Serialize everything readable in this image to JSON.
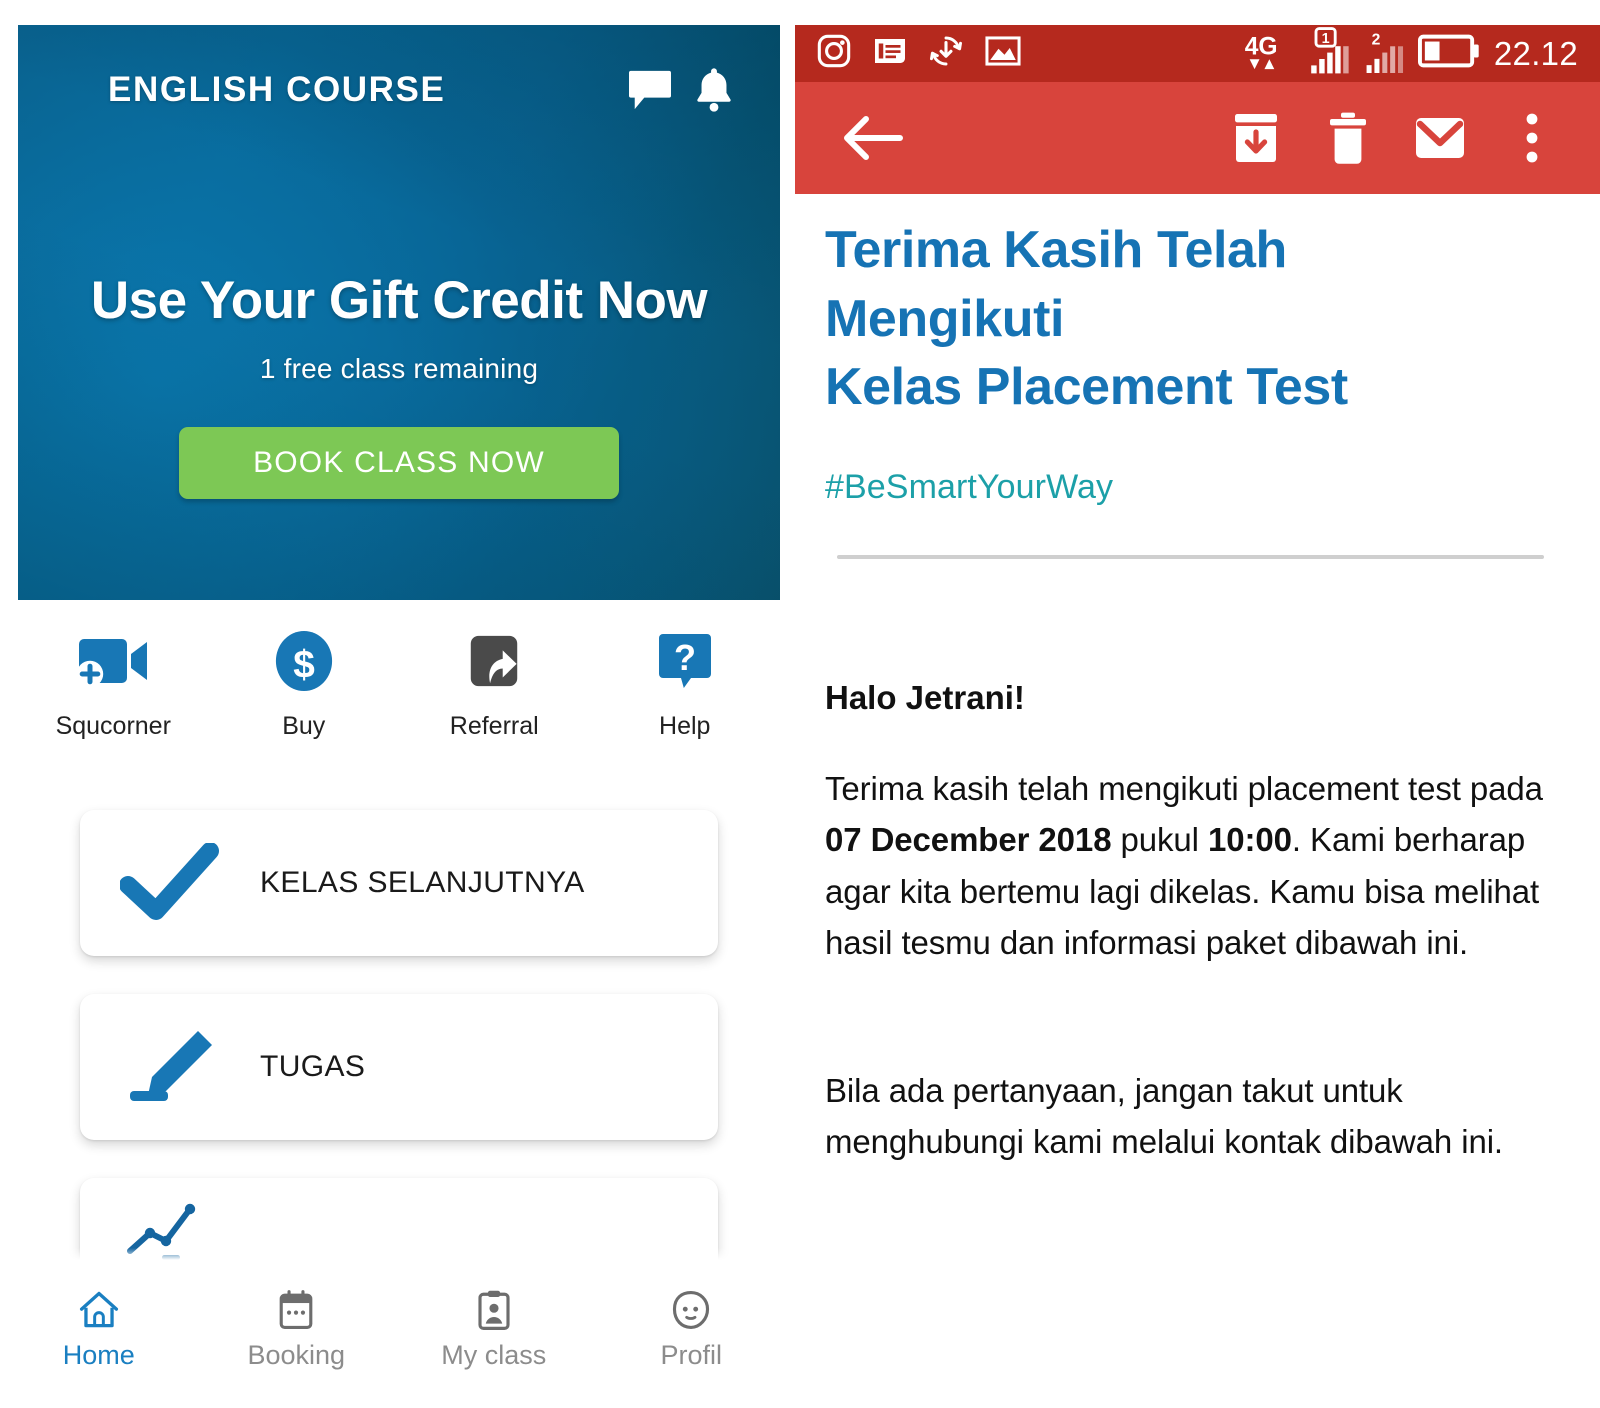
{
  "app": {
    "header": {
      "title": "ENGLISH COURSE",
      "chat_icon": "chat-bubble-icon",
      "bell_icon": "bell-icon"
    },
    "hero": {
      "headline": "Use Your Gift Credit Now",
      "subtext": "1 free class remaining",
      "button_label": "BOOK CLASS NOW",
      "button_color": "#7DC855",
      "background_color": "#0A6490"
    },
    "quick_actions": [
      {
        "label": "Squcorner",
        "icon": "video-camera-plus-icon",
        "color": "#1877B5"
      },
      {
        "label": "Buy",
        "icon": "dollar-circle-icon",
        "color": "#1877B5"
      },
      {
        "label": "Referral",
        "icon": "share-arrow-icon",
        "color": "#4A4A4A"
      },
      {
        "label": "Help",
        "icon": "question-bubble-icon",
        "color": "#1877B5"
      }
    ],
    "cards": [
      {
        "label": "KELAS SELANJUTNYA",
        "icon": "check-mark-icon"
      },
      {
        "label": "TUGAS",
        "icon": "marker-pen-icon"
      },
      {
        "label": "",
        "icon": "line-chart-icon"
      }
    ],
    "bottom_nav": [
      {
        "label": "Home",
        "icon": "home-icon",
        "active": true
      },
      {
        "label": "Booking",
        "icon": "calendar-icon",
        "active": false
      },
      {
        "label": "My class",
        "icon": "id-card-icon",
        "active": false
      },
      {
        "label": "Profil",
        "icon": "face-icon",
        "active": false
      }
    ],
    "accent_color": "#1a7fc1"
  },
  "mail": {
    "status_bar": {
      "background_color": "#B5291E",
      "left_icons": [
        "instagram-icon",
        "message-note-icon",
        "sync-download-icon",
        "photo-icon"
      ],
      "network": "4G",
      "sim1_label": "1",
      "sim2_label": "2",
      "battery_icon": "battery-icon",
      "time": "22.12"
    },
    "toolbar": {
      "background_color": "#D8443C",
      "back_icon": "back-arrow-icon",
      "archive_icon": "archive-icon",
      "delete_icon": "trash-icon",
      "mark_unread_icon": "envelope-icon",
      "overflow_icon": "more-vertical-icon"
    },
    "subject_line_1": "Terima Kasih Telah",
    "subject_line_2": "Mengikuti",
    "subject_line_3": "Kelas Placement Test",
    "subject_color": "#1673B4",
    "hashtag": "#BeSmartYourWay",
    "hashtag_color": "#1CA0A8",
    "greeting": "Halo Jetrani!",
    "paragraph_1_part1": "Terima kasih telah mengikuti placement test pada ",
    "paragraph_1_bold_date": "07 December 2018",
    "paragraph_1_part2": " pukul ",
    "paragraph_1_bold_time": "10:00",
    "paragraph_1_part3": ". Kami berharap agar kita bertemu lagi dikelas. Kamu bisa melihat hasil tesmu dan informasi paket dibawah ini.",
    "paragraph_2": "Bila ada pertanyaan, jangan takut untuk menghubungi kami melalui kontak dibawah ini."
  }
}
